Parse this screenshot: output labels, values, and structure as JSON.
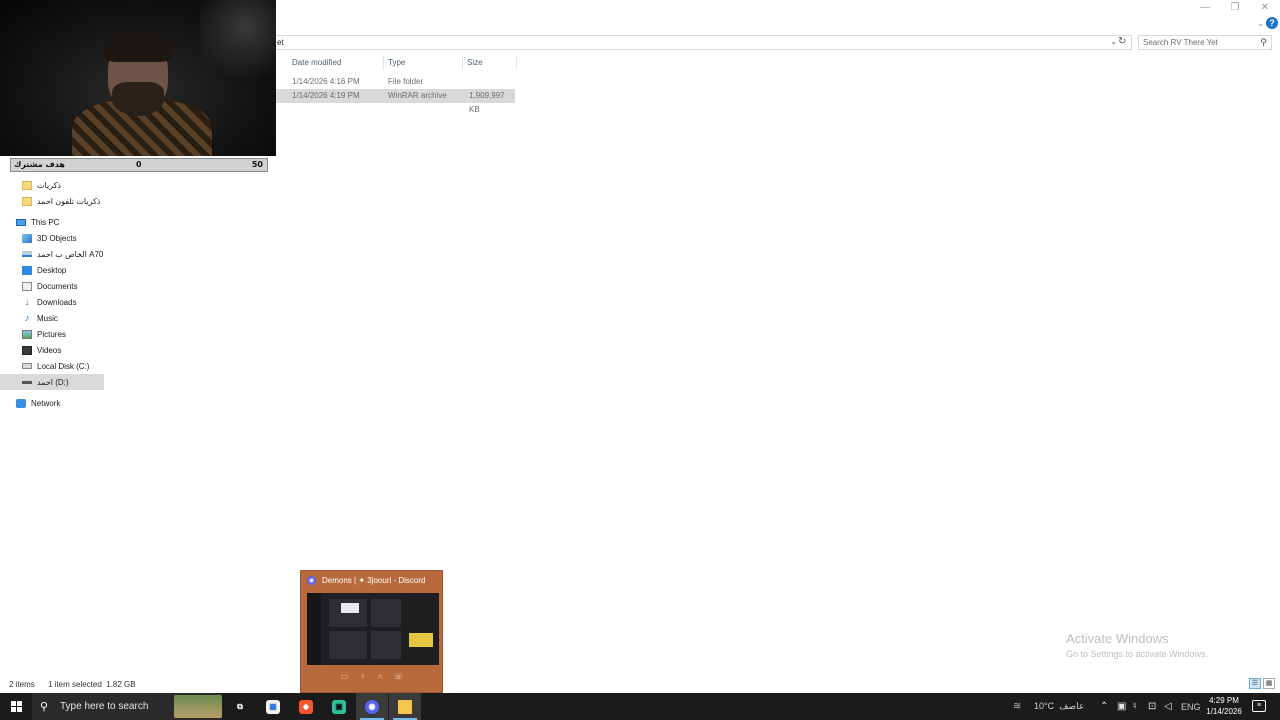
{
  "window": {
    "minimize": "—",
    "restore": "❐",
    "close": "✕",
    "collapse": "⌄",
    "help": "?"
  },
  "address": {
    "path_fragment": "et",
    "dropdown": "⌄",
    "refresh": "↻"
  },
  "search": {
    "placeholder": "Search RV There Yet"
  },
  "columns": {
    "date_modified": "Date modified",
    "type": "Type",
    "size": "Size"
  },
  "files": [
    {
      "date": "1/14/2026 4:16 PM",
      "type": "File folder",
      "size": ""
    },
    {
      "date": "1/14/2026 4:19 PM",
      "type": "WinRAR archive",
      "size": "1,909,997 KB"
    }
  ],
  "goal": {
    "label": "هدف مشترك",
    "current": "0",
    "target": "50"
  },
  "nav": {
    "quick_items": [
      "ذكريات",
      "ذكريات تلفون احمد"
    ],
    "this_pc": "This PC",
    "objects_3d": "3D Objects",
    "device_a70": "الخاص ب احمد A70",
    "desktop": "Desktop",
    "documents": "Documents",
    "downloads": "Downloads",
    "music": "Music",
    "pictures": "Pictures",
    "videos": "Videos",
    "local_disk": "Local Disk (C:)",
    "drive_d": "احمد (D:)",
    "network": "Network"
  },
  "status": {
    "items": "2 items",
    "selection": "1 item selected  1.82 GB"
  },
  "watermark": {
    "title": "Activate Windows",
    "subtitle": "Go to Settings to activate Windows."
  },
  "discord_preview": {
    "title": "Demons | ✦ 3joouri - Discord"
  },
  "taskbar": {
    "search_placeholder": "Type here to search",
    "weather": "10°C  عاصف",
    "language": "ENG",
    "time": "4:29 PM",
    "date": "1/14/2026"
  },
  "colors": {
    "taskbar": "#1b1b1b",
    "selection": "#d9d9d9",
    "preview_bg": "#b86a3c",
    "discord": "#5865f2",
    "accent": "#76b9ed"
  }
}
